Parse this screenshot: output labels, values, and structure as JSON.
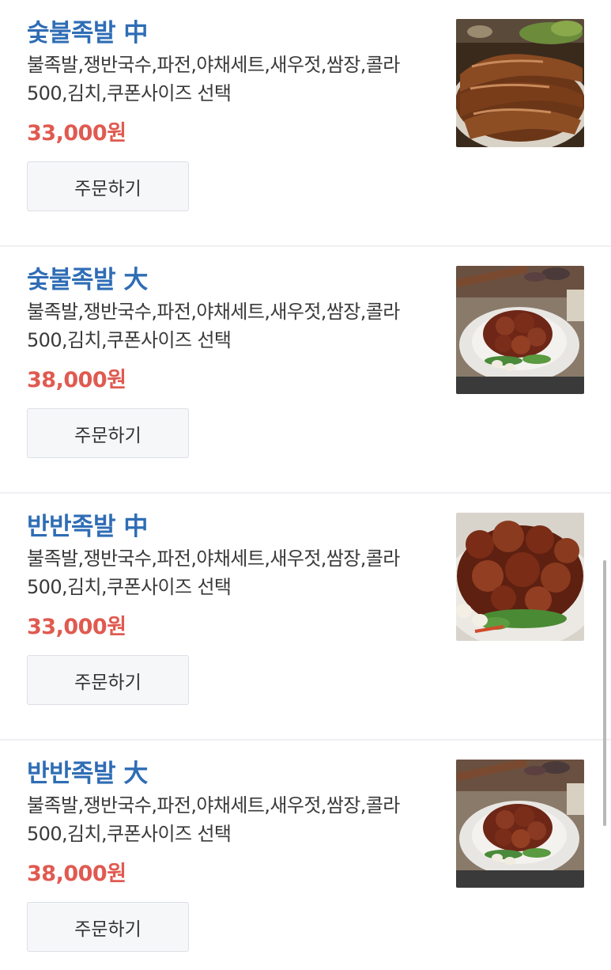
{
  "items": [
    {
      "title": "숯불족발 中",
      "description": "불족발,쟁반국수,파전,야채세트,새우젓,쌈장,콜라500,김치,쿠폰사이즈 선택",
      "price": "33,000원",
      "button_label": "주문하기",
      "image": "sliced-jokbal-photo"
    },
    {
      "title": "숯불족발 大",
      "description": "불족발,쟁반국수,파전,야채세트,새우젓,쌈장,콜라500,김치,쿠폰사이즈 선택",
      "price": "38,000원",
      "button_label": "주문하기",
      "image": "bul-jokbal-plate-photo"
    },
    {
      "title": "반반족발 中",
      "description": "불족발,쟁반국수,파전,야채세트,새우젓,쌈장,콜라500,김치,쿠폰사이즈 선택",
      "price": "33,000원",
      "button_label": "주문하기",
      "image": "bul-jokbal-closeup-photo"
    },
    {
      "title": "반반족발 大",
      "description": "불족발,쟁반국수,파전,야채세트,새우젓,쌈장,콜라500,김치,쿠폰사이즈 선택",
      "price": "38,000원",
      "button_label": "주문하기",
      "image": "bul-jokbal-plate-photo"
    }
  ],
  "colors": {
    "title": "#2f6db5",
    "price": "#e05a50",
    "button_bg": "#f6f7f9",
    "divider": "#eef0f3"
  }
}
